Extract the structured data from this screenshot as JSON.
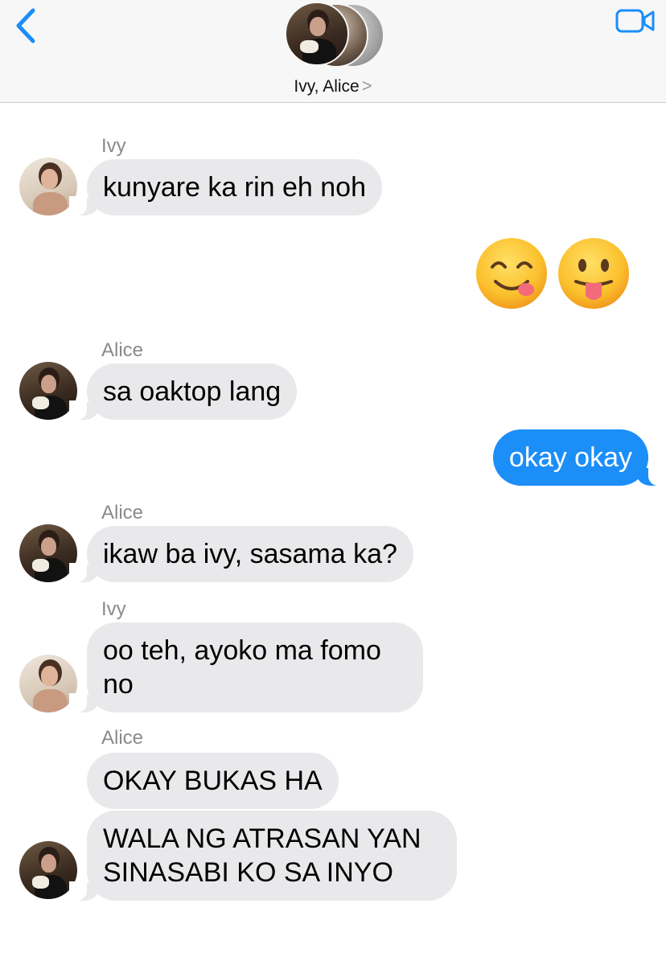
{
  "header": {
    "back_icon": "chevron-left-icon",
    "video_icon": "video-camera-icon",
    "title": "Ivy, Alice",
    "title_chevron": ">",
    "accent_color": "#1b8ef8"
  },
  "messages": [
    {
      "sender": "Ivy",
      "text": "kunyare ka rin eh noh",
      "direction": "incoming"
    },
    {
      "direction": "outgoing",
      "type": "emoji",
      "emojis": [
        "face-savoring-food-emoji",
        "face-with-tongue-emoji"
      ]
    },
    {
      "sender": "Alice",
      "text": "sa oaktop lang",
      "direction": "incoming"
    },
    {
      "text": "okay okay",
      "direction": "outgoing"
    },
    {
      "sender": "Alice",
      "text": "ikaw ba ivy, sasama ka?",
      "direction": "incoming"
    },
    {
      "sender": "Ivy",
      "text": "oo teh, ayoko ma fomo no",
      "direction": "incoming"
    },
    {
      "sender": "Alice",
      "text": "OKAY BUKAS HA",
      "direction": "incoming"
    },
    {
      "text": "WALA NG ATRASAN YAN SINASABI KO SA INYO",
      "direction": "incoming"
    }
  ],
  "colors": {
    "incoming_bubble": "#e9e9eb",
    "outgoing_bubble": "#1b8ef8",
    "sender_label": "#8a8a8e"
  }
}
